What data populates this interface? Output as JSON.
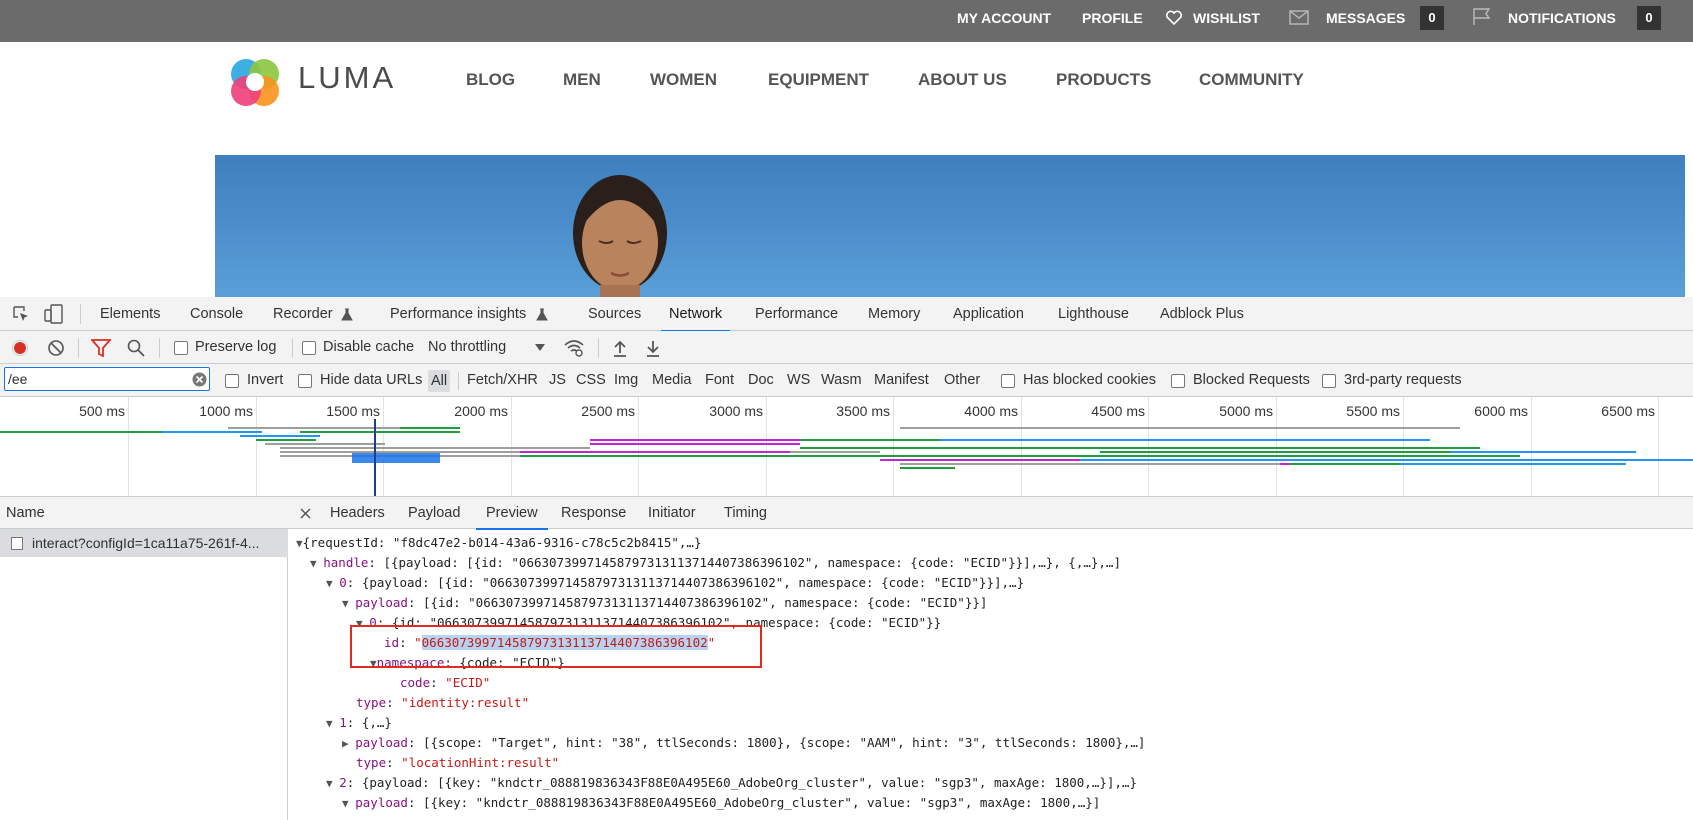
{
  "topbar": {
    "my_account": "MY ACCOUNT",
    "profile": "PROFILE",
    "wishlist": "WISHLIST",
    "messages": "MESSAGES",
    "messages_count": "0",
    "notifications": "NOTIFICATIONS",
    "notifications_count": "0"
  },
  "site": {
    "logo_text": "LUMA",
    "nav": [
      "BLOG",
      "MEN",
      "WOMEN",
      "EQUIPMENT",
      "ABOUT US",
      "PRODUCTS",
      "COMMUNITY"
    ]
  },
  "devtools": {
    "tabs": [
      "Elements",
      "Console",
      "Recorder",
      "Performance insights",
      "Sources",
      "Network",
      "Performance",
      "Memory",
      "Application",
      "Lighthouse",
      "Adblock Plus"
    ],
    "selected_tab": "Network",
    "toolbar": {
      "preserve_log": "Preserve log",
      "disable_cache": "Disable cache",
      "throttling": "No throttling"
    },
    "filter": {
      "value": "/ee",
      "invert": "Invert",
      "hide_data_urls": "Hide data URLs",
      "types": [
        "All",
        "Fetch/XHR",
        "JS",
        "CSS",
        "Img",
        "Media",
        "Font",
        "Doc",
        "WS",
        "Wasm",
        "Manifest",
        "Other"
      ],
      "has_blocked_cookies": "Has blocked cookies",
      "blocked_requests": "Blocked Requests",
      "third_party": "3rd-party requests"
    },
    "timeline": {
      "ticks": [
        "500 ms",
        "1000 ms",
        "1500 ms",
        "2000 ms",
        "2500 ms",
        "3000 ms",
        "3500 ms",
        "4000 ms",
        "4500 ms",
        "5000 ms",
        "5500 ms",
        "6000 ms",
        "6500 ms"
      ]
    },
    "requests": {
      "header": "Name",
      "items": [
        "interact?configId=1ca11a75-261f-4..."
      ]
    },
    "detail": {
      "tabs": [
        "Headers",
        "Payload",
        "Preview",
        "Response",
        "Initiator",
        "Timing"
      ],
      "selected": "Preview",
      "lines": {
        "l0_a": "{requestId: \"f8dc47e2-b014-43a6-9316-c78c5c2b8415\",…}",
        "l1_k": "handle",
        "l1_v": ": [{payload: [{id: \"06630739971458797313113714407386396102\", namespace: {code: \"ECID\"}}],…}, {,…},…]",
        "l2_k": "0",
        "l2_v": ": {payload: [{id: \"06630739971458797313113714407386396102\", namespace: {code: \"ECID\"}}],…}",
        "l3_k": "payload",
        "l3_v": ": [{id: \"06630739971458797313113714407386396102\", namespace: {code: \"ECID\"}}]",
        "l4_k": "0",
        "l4_v": ": {id: \"06630739971458797313113714407386396102\", namespace: {code: \"ECID\"}}",
        "l5_k": "id",
        "l5_v": "06630739971458797313113714407386396102",
        "l6_k": "namespace",
        "l6_v": ": {code: \"ECID\"}",
        "l7_k": "code",
        "l7_v": "\"ECID\"",
        "l8_k": "type",
        "l8_v": "\"identity:result\"",
        "l9_k": "1",
        "l9_v": ": {,…}",
        "l10_k": "payload",
        "l10_v": ": [{scope: \"Target\", hint: \"38\", ttlSeconds: 1800}, {scope: \"AAM\", hint: \"3\", ttlSeconds: 1800},…]",
        "l11_k": "type",
        "l11_v": "\"locationHint:result\"",
        "l12_k": "2",
        "l12_v": ": {payload: [{key: \"kndctr_088819836343F88E0A495E60_AdobeOrg_cluster\", value: \"sgp3\", maxAge: 1800,…}],…}",
        "l13_k": "payload",
        "l13_v": ": [{key: \"kndctr_088819836343F88E0A495E60_AdobeOrg_cluster\", value: \"sgp3\", maxAge: 1800,…}]"
      }
    }
  }
}
